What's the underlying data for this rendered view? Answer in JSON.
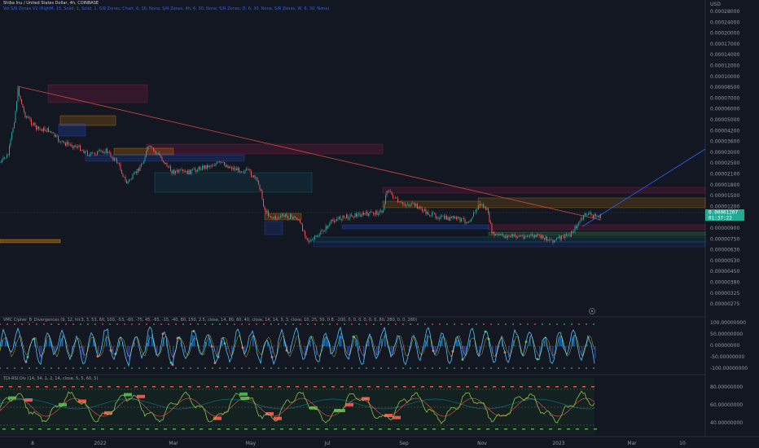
{
  "header": {
    "symbol_line": "Shiba Inu / United States Dollar, 4h, COINBASE",
    "indicator_line": "Vol S/R Zones V2 (RighM, 15, Solid, 1, Solid, 1, S/R Zones, Chart, 6, 30, None, S/R Zones, 4h, 6, 30, None, S/R Zones, D, 6, 30, None, S/R Zones, W, 6, 30, None)"
  },
  "price_axis": {
    "currency": "USD",
    "labels": [
      "0.00028000",
      "0.00024000",
      "0.00020000",
      "0.00017000",
      "0.00014000",
      "0.00012000",
      "0.00010000",
      "0.00008500",
      "0.00007000",
      "0.00006000",
      "0.00005000",
      "0.00004200",
      "0.00003600",
      "0.00003000",
      "0.00002500",
      "0.00002100",
      "0.00001800",
      "0.00001500",
      "0.00001200",
      "0.00001050",
      "0.00000900",
      "0.00000750",
      "0.00000630",
      "0.00000530",
      "0.00000450",
      "0.00000380",
      "0.00000325",
      "0.00000275"
    ],
    "current_price": "0.00001207",
    "countdown": "01:37:22",
    "secondary_tag": "0.00001050"
  },
  "time_axis": {
    "labels": [
      "8",
      "2022",
      "Mar",
      "May",
      "Jul",
      "Sep",
      "Nov",
      "2023",
      "Mar",
      "10"
    ]
  },
  "panes": {
    "vmc": {
      "title": "VMC Cipher_B_Divergences (9, 12, hlc3, 3, 53, 60, 100, -53, -60, -75, 45, -65, -15, -40, 80, 150, 2.5, close, 14, 80, 60, 40, close, 14, 14, 3, 3, close, 10, 25, 50, 0.8, -200, 0, 0, 0, 0, 0, 0, 60, 280, 0, 0, 280)",
      "labels": [
        "100.00000000",
        "50.00000000",
        "0.00000000",
        "-50.00000000",
        "-100.00000000"
      ]
    },
    "rsi": {
      "title": "TDI-RSI Div (14, 34, 1, 2, 14, close, 5, 5, 60, 5)",
      "labels": [
        "80.00000000",
        "60.00000000",
        "40.00000000"
      ]
    }
  },
  "colors": {
    "background": "#131722",
    "candle_up": "#26a69a",
    "candle_down": "#ef5350",
    "current_price_bg": "#22ab94",
    "trend_line_red": "#d64a3d",
    "trend_line_blue": "#2962ff"
  },
  "icons": {
    "settings": "settings-icon"
  }
}
